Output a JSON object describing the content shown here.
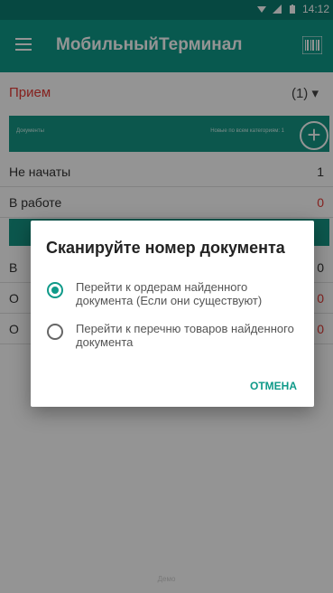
{
  "statusbar": {
    "time": "14:12"
  },
  "appbar": {
    "title": "МобильныйТерминал"
  },
  "section": {
    "title": "Прием",
    "count": "(1)"
  },
  "document_bar": {
    "label": "Документы",
    "hint": "Новые по всем категориям: 1",
    "add_label": "+"
  },
  "rows": [
    {
      "label": "Не начаты",
      "value": "1"
    },
    {
      "label": "В работе",
      "value": "0"
    },
    {
      "label": "В",
      "value": "0"
    },
    {
      "label": "О",
      "value": "0"
    },
    {
      "label": "О",
      "value": "0"
    }
  ],
  "dialog": {
    "title": "Сканируйте номер документа",
    "options": [
      {
        "label": "Перейти к ордерам найденного документа (Если они существуют)"
      },
      {
        "label": "Перейти к перечню товаров найденного документа"
      }
    ],
    "cancel": "ОТМЕНА"
  },
  "footer": "Демо",
  "colors": {
    "accent": "#0f9a89",
    "red": "#e53935"
  }
}
